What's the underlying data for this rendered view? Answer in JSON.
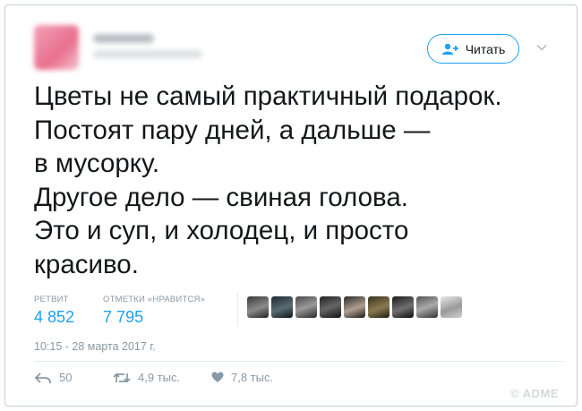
{
  "tweet": {
    "follow_label": "Читать",
    "text_lines": [
      "Цветы не самый практичный подарок.",
      "Постоят пару дней, а дальше —",
      "в мусорку.",
      "Другое дело — свиная голова.",
      "Это и суп, и холодец, и просто",
      "красиво."
    ],
    "retweets_label": "РЕТВИТ",
    "retweets_value": "4 852",
    "likes_label": "ОТМЕТКИ «НРАВИТСЯ»",
    "likes_value": "7 795",
    "timestamp": "10:15 - 28 марта 2017 г.",
    "reply_count": "50",
    "retweet_count": "4,9 тыс.",
    "like_count": "7,8 тыс."
  },
  "watermark": "© ADME",
  "colors": {
    "accent": "#1da1f2",
    "muted": "#8899a6",
    "text": "#14171a"
  },
  "liker_avatars": [
    "liker-1",
    "liker-2",
    "liker-3",
    "liker-4",
    "liker-5",
    "liker-6",
    "liker-7",
    "liker-8",
    "liker-9"
  ]
}
